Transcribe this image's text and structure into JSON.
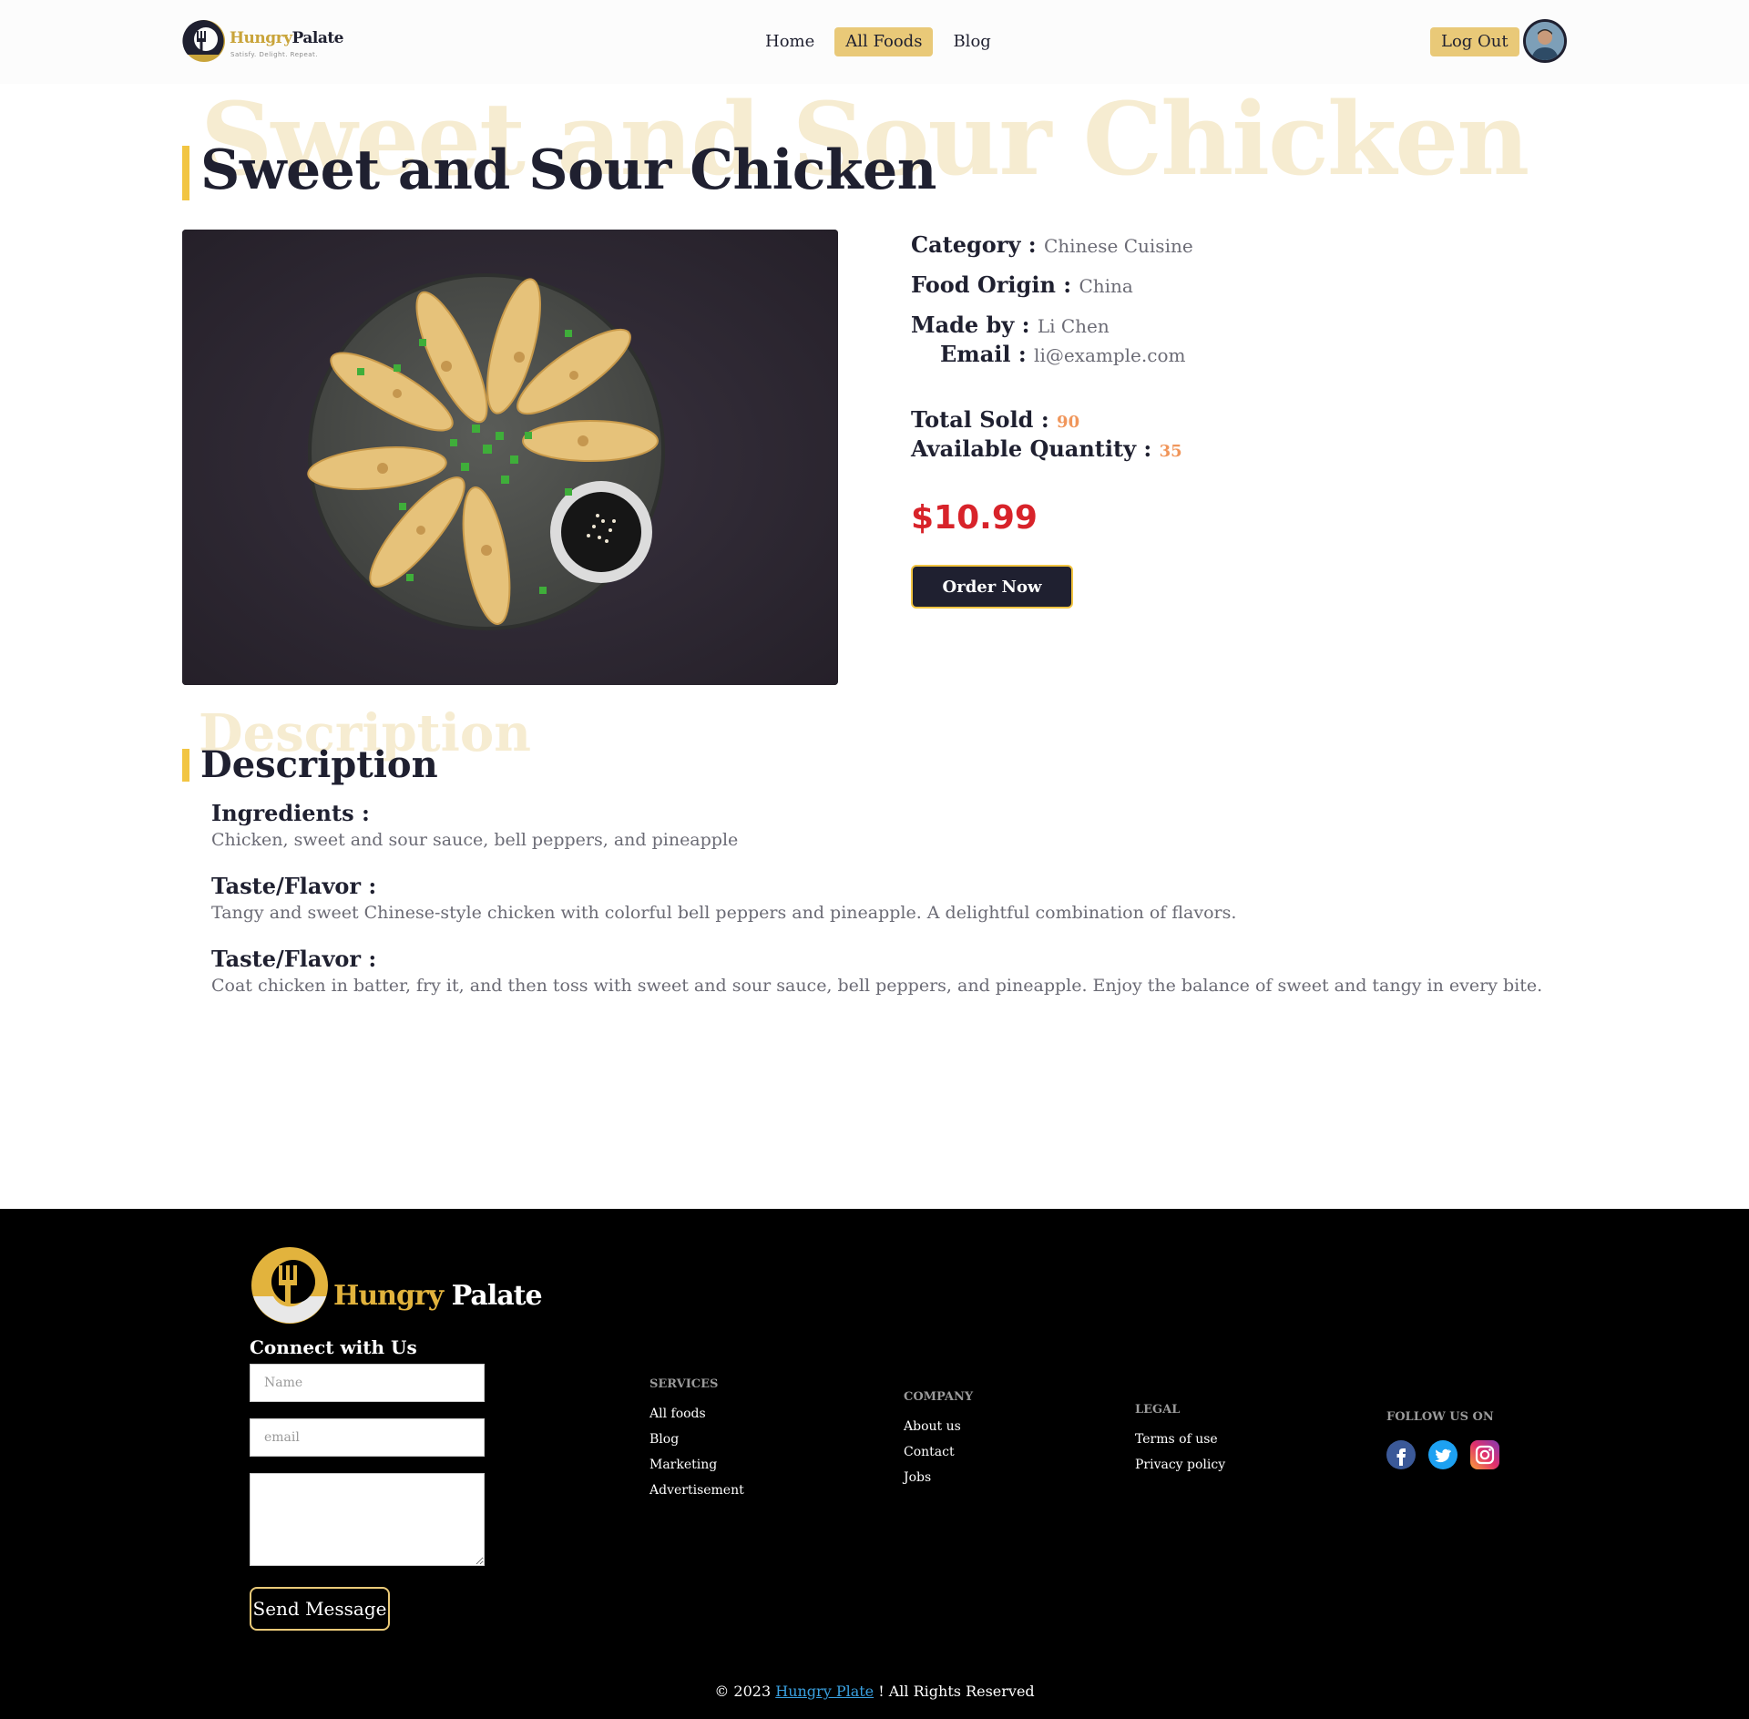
{
  "brand": {
    "logo_word1": "Hungry",
    "logo_word2": "Palate",
    "tagline": "Satisfy. Delight. Repeat."
  },
  "nav": {
    "items": [
      {
        "label": "Home"
      },
      {
        "label": "All Foods"
      },
      {
        "label": "Blog"
      }
    ],
    "active": "All Foods",
    "logout_label": "Log Out"
  },
  "food": {
    "title": "Sweet and Sour Chicken",
    "category_label": "Category :",
    "category": "Chinese Cuisine",
    "origin_label": "Food Origin :",
    "origin": "China",
    "made_by_label": "Made by :",
    "made_by": "Li Chen",
    "email_label": "Email :",
    "email": "li@example.com",
    "total_sold_label": "Total Sold :",
    "total_sold": "90",
    "available_label": "Available Quantity :",
    "available": "35",
    "price": "$10.99",
    "order_label": "Order Now"
  },
  "description": {
    "title": "Description",
    "sections": [
      {
        "label": "Ingredients :",
        "text": "Chicken, sweet and sour sauce, bell peppers, and pineapple"
      },
      {
        "label": "Taste/Flavor :",
        "text": "Tangy and sweet Chinese-style chicken with colorful bell peppers and pineapple. A delightful combination of flavors."
      },
      {
        "label": "Taste/Flavor :",
        "text": "Coat chicken in batter, fry it, and then toss with sweet and sour sauce, bell peppers, and pineapple. Enjoy the balance of sweet and tangy in every bite."
      }
    ]
  },
  "footer": {
    "logo_word1": "Hungry",
    "logo_word2": "Palate",
    "connect_title": "Connect with Us",
    "name_placeholder": "Name",
    "email_placeholder": "email",
    "send_label": "Send Message",
    "services": {
      "title": "SERVICES",
      "links": [
        "All foods",
        "Blog",
        "Marketing",
        "Advertisement"
      ]
    },
    "company": {
      "title": "COMPANY",
      "links": [
        "About us",
        "Contact",
        "Jobs"
      ]
    },
    "legal": {
      "title": "LEGAL",
      "links": [
        "Terms of use",
        "Privacy policy"
      ]
    },
    "follow_title": "FOLLOW US ON",
    "social_icons": [
      "facebook-icon",
      "twitter-icon",
      "instagram-icon"
    ],
    "copyright_prefix": "© 2023",
    "copyright_brand": "Hungry Plate",
    "copyright_suffix": "! All Rights Reserved"
  },
  "colors": {
    "accent_yellow": "#f2c542",
    "nav_active_bg": "#e9c978",
    "price_red": "#d8232a",
    "count_orange": "#f0965b",
    "dark": "#1f2030"
  }
}
